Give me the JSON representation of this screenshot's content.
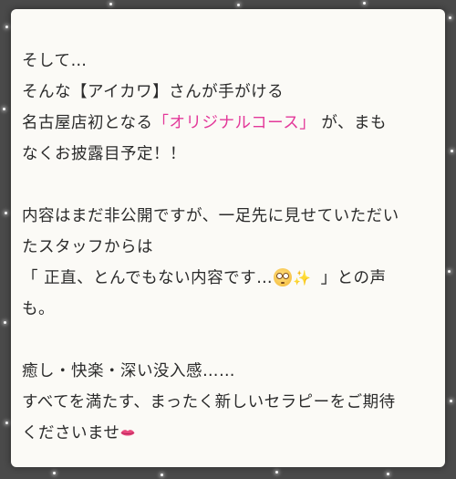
{
  "post": {
    "line1": "そして…",
    "line2": "そんな【アイカワ】さんが手がける",
    "line3_prefix": "名古屋店初となる",
    "line3_highlight": "「オリジナルコース」",
    "line3_suffix": " が、まも",
    "line4": "なくお披露目予定！！",
    "line6": "内容はまだ非公開ですが、一足先に見せていただい",
    "line7": "たスタッフからは",
    "line8_prefix": "「 正直、とんでもない内容です…",
    "line8_suffix": " 」との声",
    "line9": "も。",
    "line11": "癒し・快楽・深い没入感……",
    "line12": "すべてを満たす、まったく新しいセラピーをご期待",
    "line13": "くださいませ"
  },
  "emoji": {
    "face": "flushed-face-icon",
    "sparkles": "sparkles-icon",
    "lips": "lips-icon"
  },
  "colors": {
    "highlight": "#e3399a",
    "card_background": "#fbfaf6",
    "page_background": "#4a4a4a",
    "text": "#2b2b2b"
  }
}
